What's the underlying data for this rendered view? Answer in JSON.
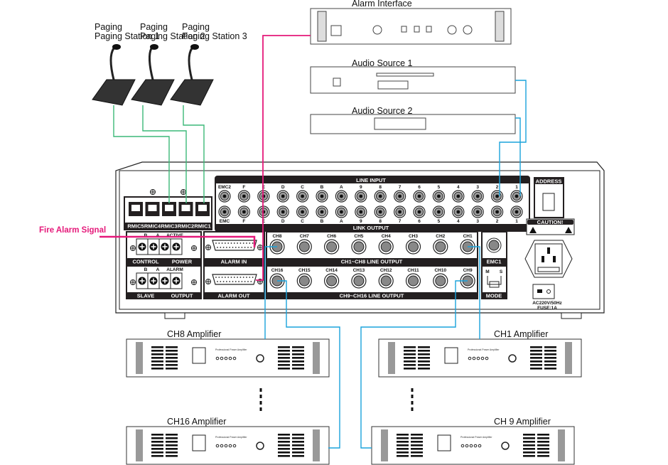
{
  "paging_stations": [
    "Paging Station 1",
    "Paging Station 2",
    "Paging Station 3"
  ],
  "equipment": {
    "alarm_interface": "Alarm Interface",
    "audio_source_1": "Audio Source 1",
    "audio_source_2": "Audio Source 2",
    "amp_ch8": "CH8 Amplifier",
    "amp_ch1": "CH1 Amplifier",
    "amp_ch16": "CH16 Amplifier",
    "amp_ch9": "CH 9 Amplifier",
    "amp_panel_text": "Professional Power Amplifier"
  },
  "fire_alarm_signal": "Fire Alarm Signal",
  "main_unit": {
    "line_input": "LINE INPUT",
    "link_output": "LINK OUTPUT",
    "line_input_labels": [
      "EMC2",
      "F",
      "E",
      "D",
      "C",
      "B",
      "A",
      "9",
      "8",
      "7",
      "6",
      "5",
      "4",
      "3",
      "2",
      "1"
    ],
    "link_output_labels": [
      "EMC",
      "F",
      "E",
      "D",
      "C",
      "B",
      "A",
      "9",
      "8",
      "7",
      "6",
      "5",
      "4",
      "3",
      "2",
      "1"
    ],
    "rmic_labels": [
      "RMIC5",
      "RMIC4",
      "RMIC3",
      "RMIC2",
      "RMIC1"
    ],
    "control_terminals": [
      "B",
      "A",
      "ACTIVE"
    ],
    "control_title": "CONTROL",
    "power_title": "POWER",
    "slave_terminals": [
      "B",
      "A",
      "ALARM"
    ],
    "slave_title": "SLAVE",
    "output_title": "OUTPUT",
    "alarm_in": "ALARM IN",
    "alarm_out": "ALARM OUT",
    "ch1_8_labels": [
      "CH8",
      "CH7",
      "CH6",
      "CH5",
      "CH4",
      "CH3",
      "CH2",
      "CH1"
    ],
    "ch1_8_title": "CH1~CH8  LINE OUTPUT",
    "ch9_16_labels": [
      "CH16",
      "CH15",
      "CH14",
      "CH13",
      "CH12",
      "CH11",
      "CH10",
      "CH9"
    ],
    "ch9_16_title": "CH9~CH16  LINE OUTPUT",
    "emc1": "EMC1",
    "mode_m": "M",
    "mode_s": "S",
    "mode": "MODE",
    "address": "ADDRESS",
    "caution": "CAUTION!",
    "power_rating": "AC220V/50Hz",
    "fuse": "FUSE:1A"
  },
  "colors": {
    "alarm": "#e5197a",
    "audio": "#1aa3dc",
    "mic": "#3cb878",
    "panel": "#231f20"
  }
}
